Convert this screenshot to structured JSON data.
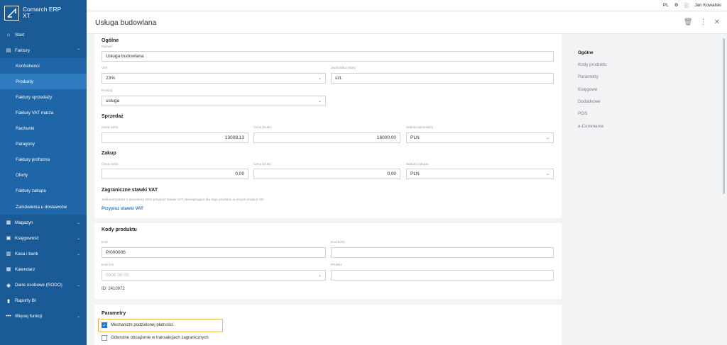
{
  "app": {
    "brand_line1": "Comarch ERP",
    "brand_line2": "XT"
  },
  "topbar": {
    "lang": "PL",
    "user": "Jan Kowalski"
  },
  "sidebar": {
    "items": [
      {
        "label": "Start",
        "icon": "home-icon"
      },
      {
        "label": "Faktury",
        "icon": "invoice-icon",
        "expanded": true
      },
      {
        "label": "Kontrahenci",
        "sub": true
      },
      {
        "label": "Produkty",
        "sub": true,
        "active": true
      },
      {
        "label": "Faktury sprzedaży",
        "sub": true
      },
      {
        "label": "Faktury VAT marża",
        "sub": true
      },
      {
        "label": "Rachunki",
        "sub": true
      },
      {
        "label": "Paragony",
        "sub": true
      },
      {
        "label": "Faktury proforma",
        "sub": true
      },
      {
        "label": "Oferty",
        "sub": true
      },
      {
        "label": "Faktury zakupu",
        "sub": true
      },
      {
        "label": "Zamówienia u dostawców",
        "sub": true
      },
      {
        "label": "Magazyn",
        "icon": "warehouse-icon",
        "chevron": true
      },
      {
        "label": "Księgowość",
        "icon": "accounting-icon",
        "chevron": true
      },
      {
        "label": "Kasa i bank",
        "icon": "bank-icon",
        "chevron": true
      },
      {
        "label": "Kalendarz",
        "icon": "calendar-icon"
      },
      {
        "label": "Dane osobowe (RODO)",
        "icon": "personal-data-icon",
        "chevron": true
      },
      {
        "label": "Raporty BI",
        "icon": "chart-icon"
      },
      {
        "label": "Więcej funkcji",
        "icon": "more-icon",
        "chevron": true
      }
    ]
  },
  "header": {
    "title": "Usługa budowlana"
  },
  "general": {
    "title": "Ogólne",
    "name_label": "Nazwa",
    "name_value": "Usługa budowlana",
    "vat_label": "VAT",
    "vat_value": "23%",
    "unit_label": "Jednostka miary",
    "unit_value": "szt.",
    "type_label": "Rodzaj",
    "type_value": "usługa",
    "sales_title": "Sprzedaż",
    "net_label": "Cena netto",
    "net_value": "13008,13",
    "gross_label": "Cena brutto",
    "gross_value": "16000,00",
    "sales_currency_label": "Waluta sprzedaży",
    "sales_currency_value": "PLN",
    "purchase_title": "Zakup",
    "p_net_label": "Cena netto",
    "p_net_value": "0,00",
    "p_gross_label": "Cena brutto",
    "p_gross_value": "0,00",
    "purchase_currency_label": "Waluta zakupu",
    "purchase_currency_value": "PLN",
    "foreign_title": "Zagraniczne stawki VAT",
    "foreign_note": "Jeśli korzystasz z procedury OSS przypisz stawki VAT obowiązujące dla tego produktu w innych krajach UE",
    "foreign_link": "Przypisz stawki VAT"
  },
  "codes": {
    "title": "Kody produktu",
    "code_label": "Kod",
    "code_value": "P/000006",
    "ean_label": "Kod EAN",
    "ean_value": "",
    "cn_label": "Kod CN",
    "cn_value": "0000 00 00",
    "pkwiu_label": "PKWiU",
    "pkwiu_value": "",
    "id_text": "ID: 2410972"
  },
  "params": {
    "title": "Parametry",
    "split_payment_label": "Mechanizm podzielonej płatności",
    "split_payment_checked": true,
    "reverse_charge_label": "Odwrotne obciążenie w transakcjach zagranicznych",
    "reverse_charge_checked": false
  },
  "rightnav": {
    "items": [
      "Ogólne",
      "Kody produktu",
      "Parametry",
      "Księgowe",
      "Dodatkowe",
      "POS",
      "e-Commerce"
    ]
  },
  "colors": {
    "sidebar": "#1a5a96",
    "active": "#2f7bc0",
    "accent": "#2a7ac6",
    "highlight": "#e8b84a"
  }
}
